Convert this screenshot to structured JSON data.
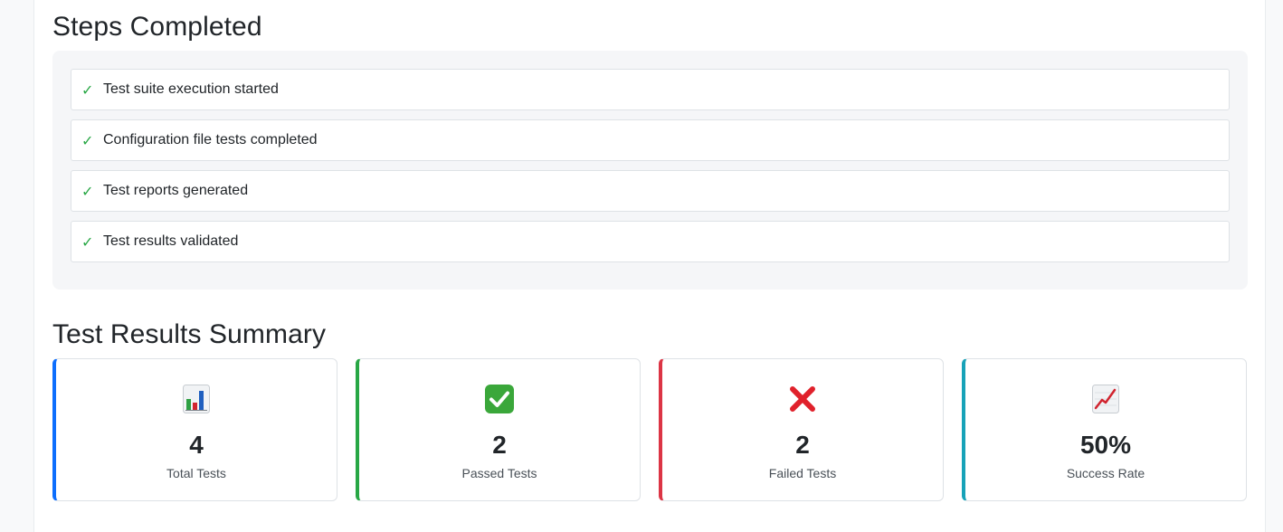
{
  "steps_section": {
    "title": "Steps Completed",
    "check_glyph": "✓",
    "items": [
      {
        "label": "Test suite execution started"
      },
      {
        "label": "Configuration file tests completed"
      },
      {
        "label": "Test reports generated"
      },
      {
        "label": "Test results validated"
      }
    ]
  },
  "summary_section": {
    "title": "Test Results Summary",
    "cards": [
      {
        "icon": "bar-chart-icon",
        "value": "4",
        "label": "Total Tests",
        "accent": "#0d6efd"
      },
      {
        "icon": "check-box-icon",
        "value": "2",
        "label": "Passed Tests",
        "accent": "#28a745"
      },
      {
        "icon": "cross-mark-icon",
        "value": "2",
        "label": "Failed Tests",
        "accent": "#dc3545"
      },
      {
        "icon": "trend-up-icon",
        "value": "50%",
        "label": "Success Rate",
        "accent": "#17a2b8"
      }
    ]
  },
  "colors": {
    "check": "#28a745",
    "panel_bg": "#f5f6f8"
  }
}
